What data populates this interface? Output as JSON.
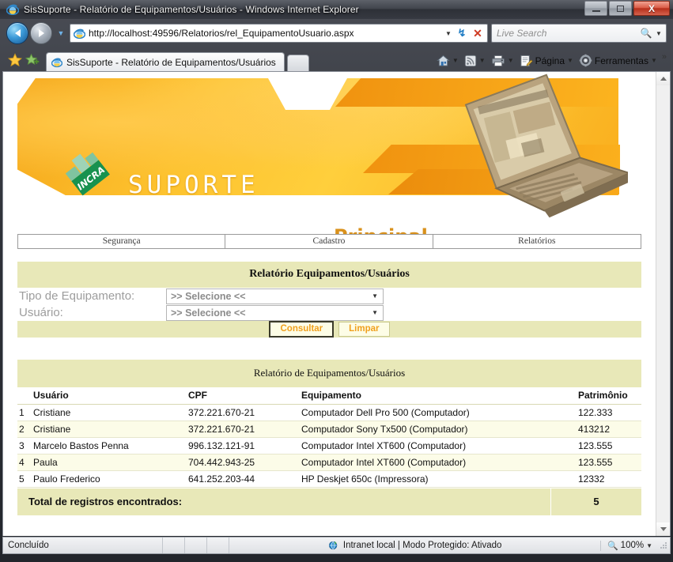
{
  "window": {
    "title": "SisSuporte - Relatório de Equipamentos/Usuários - Windows Internet Explorer",
    "minimize_label": "Minimizar",
    "maximize_label": "Maximizar",
    "close_label": "X"
  },
  "browser": {
    "url": "http://localhost:49596/Relatorios/rel_EquipamentoUsuario.aspx",
    "search_placeholder": "Live Search",
    "refresh_glyph": "↯",
    "stop_glyph": "✕",
    "tab_label": "SisSuporte - Relatório de Equipamentos/Usuários",
    "commands": [
      {
        "label": "",
        "icon": "home-icon"
      },
      {
        "label": "",
        "icon": "feeds-icon"
      },
      {
        "label": "",
        "icon": "print-icon"
      },
      {
        "label": "Página",
        "icon": "page-icon"
      },
      {
        "label": "Ferramentas",
        "icon": "tools-icon"
      }
    ],
    "more_commands": "»"
  },
  "banner": {
    "system_name": "SUPORTE",
    "section": "Principal",
    "logo_alt": "INCRA"
  },
  "nav": {
    "items": [
      {
        "label": "Segurança"
      },
      {
        "label": "Cadastro"
      },
      {
        "label": "Relatórios"
      }
    ]
  },
  "form": {
    "title": "Relatório Equipamentos/Usuários",
    "fields": [
      {
        "label": "Tipo de Equipamento:",
        "value": ">> Selecione <<"
      },
      {
        "label": "Usuário:",
        "value": ">> Selecione <<"
      }
    ],
    "buttons": {
      "submit": "Consultar",
      "clear": "Limpar"
    }
  },
  "report": {
    "title": "Relatório de Equipamentos/Usuários",
    "columns": [
      "",
      "Usuário",
      "CPF",
      "Equipamento",
      "Patrimônio"
    ],
    "rows": [
      {
        "idx": "1",
        "usuario": "Cristiane",
        "cpf": "372.221.670-21",
        "equipamento": "Computador Dell Pro 500 (Computador)",
        "patrimonio": "122.333"
      },
      {
        "idx": "2",
        "usuario": "Cristiane",
        "cpf": "372.221.670-21",
        "equipamento": "Computador Sony Tx500 (Computador)",
        "patrimonio": "413212"
      },
      {
        "idx": "3",
        "usuario": "Marcelo Bastos Penna",
        "cpf": "996.132.121-91",
        "equipamento": "Computador Intel XT600 (Computador)",
        "patrimonio": "123.555"
      },
      {
        "idx": "4",
        "usuario": "Paula",
        "cpf": "704.442.943-25",
        "equipamento": "Computador Intel XT600 (Computador)",
        "patrimonio": "123.555"
      },
      {
        "idx": "5",
        "usuario": "Paulo Frederico",
        "cpf": "641.252.203-44",
        "equipamento": "HP Deskjet 650c (Impressora)",
        "patrimonio": "12332"
      }
    ],
    "total_label": "Total de registros encontrados:",
    "total_value": "5"
  },
  "statusbar": {
    "status": "Concluído",
    "zone": "Intranet local | Modo Protegido: Ativado",
    "zoom": "100%"
  },
  "colors": {
    "banner_orange": "#fdc22e",
    "panel_khaki": "#e8e8b8",
    "button_orange": "#f0a01e",
    "alt_row": "#fcfce8",
    "incra_green": "#1f9455"
  }
}
